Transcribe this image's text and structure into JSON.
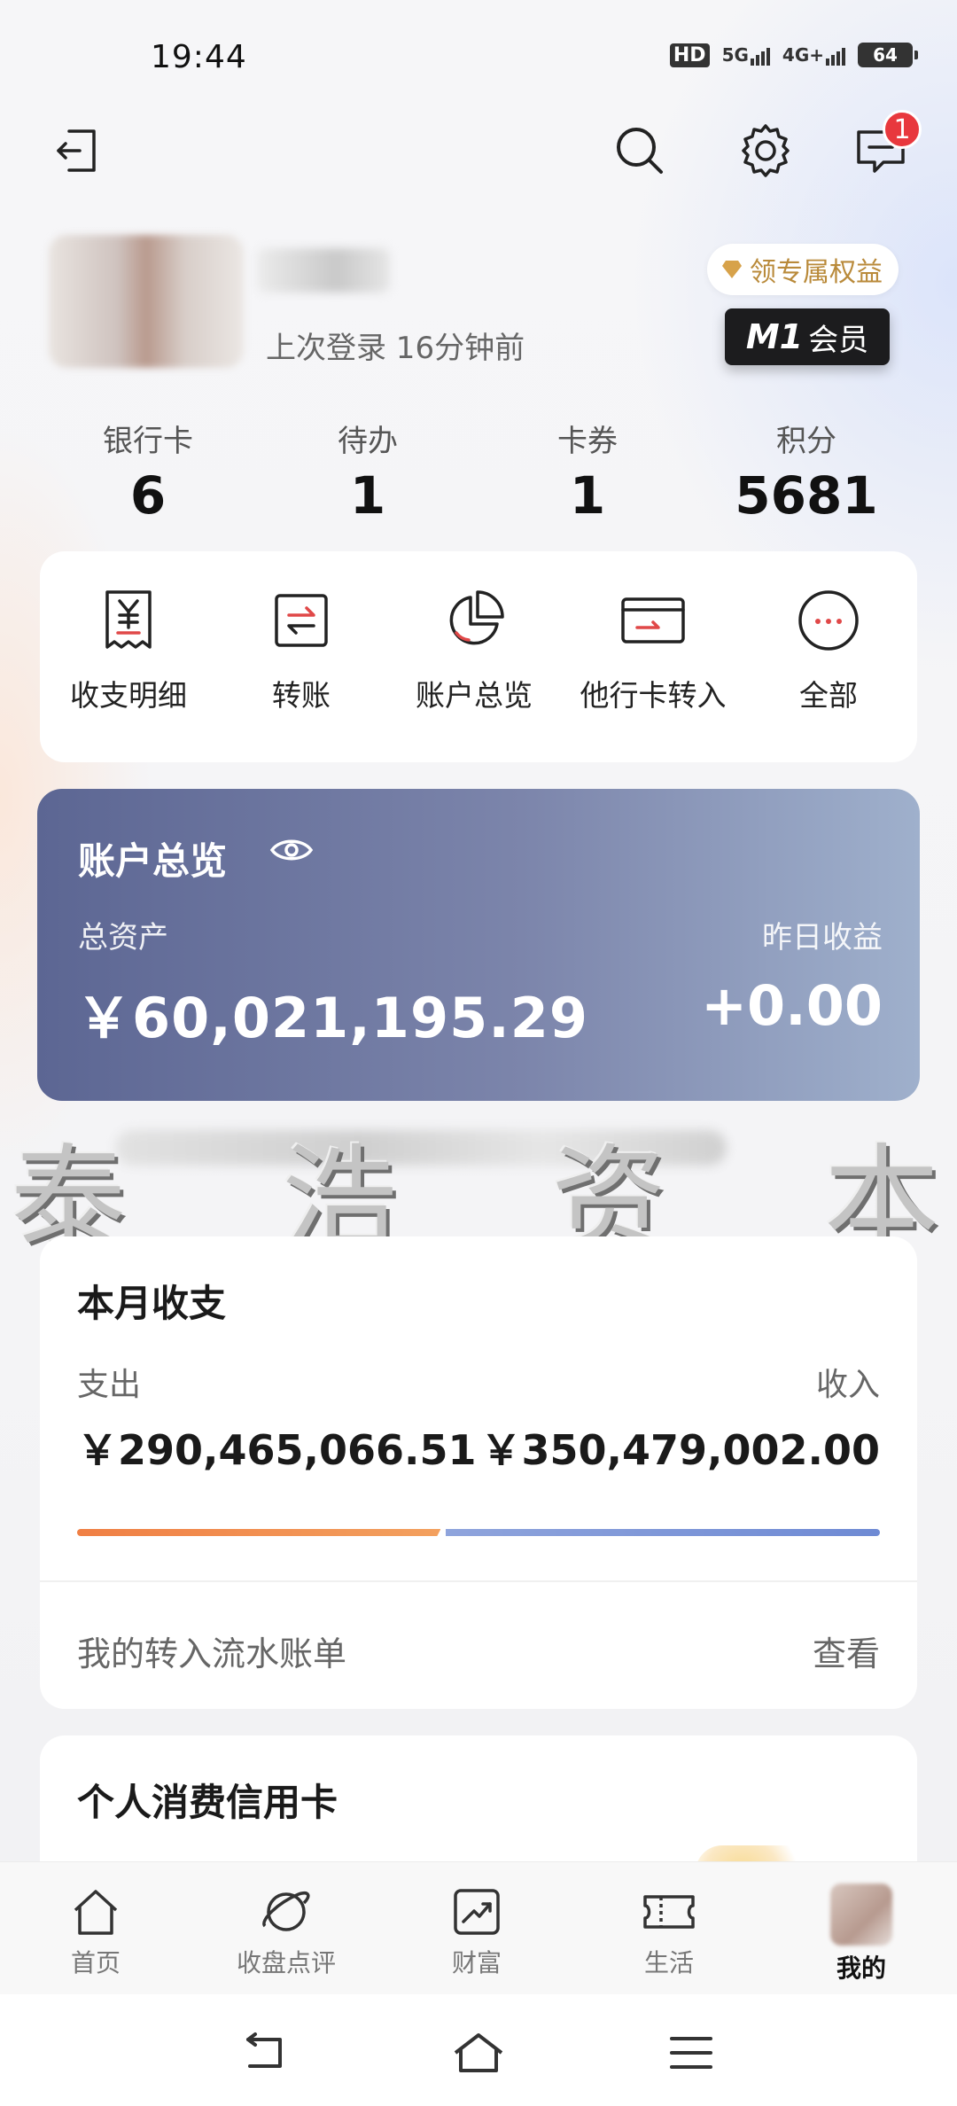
{
  "status_bar": {
    "time": "19:44",
    "signal_hd": "HD",
    "net_1": "5G",
    "net_2": "4G+",
    "battery": "64"
  },
  "header": {
    "unread_count": "1"
  },
  "profile": {
    "last_login": "上次登录 16分钟前",
    "benefit_label": "领专属权益",
    "member_level": "M1",
    "member_label": "会员"
  },
  "stats": [
    {
      "label": "银行卡",
      "value": "6"
    },
    {
      "label": "待办",
      "value": "1"
    },
    {
      "label": "卡券",
      "value": "1"
    },
    {
      "label": "积分",
      "value": "5681"
    }
  ],
  "quick_actions": [
    {
      "label": "收支明细",
      "icon": "receipt-icon"
    },
    {
      "label": "转账",
      "icon": "transfer-icon"
    },
    {
      "label": "账户总览",
      "icon": "pie-chart-icon"
    },
    {
      "label": "他行卡转入",
      "icon": "card-in-icon"
    },
    {
      "label": "全部",
      "icon": "more-icon"
    }
  ],
  "overview": {
    "title": "账户总览",
    "total_label": "总资产",
    "total_value": "￥60,021,195.29",
    "yield_label": "昨日收益",
    "yield_value": "+0.00"
  },
  "watermark": [
    "泰",
    "浩",
    "资",
    "本"
  ],
  "monthly": {
    "title": "本月收支",
    "expense_label": "支出",
    "income_label": "收入",
    "expense_value": "￥290,465,066.51",
    "income_value": "￥350,479,002.00",
    "expense_share": 0.453,
    "link_text": "我的转入流水账单",
    "link_action": "查看"
  },
  "credit": {
    "title": "个人消费信用卡"
  },
  "tabs": [
    {
      "label": "首页",
      "icon": "home-icon"
    },
    {
      "label": "收盘点评",
      "icon": "planet-icon"
    },
    {
      "label": "财富",
      "icon": "wealth-chart-icon"
    },
    {
      "label": "生活",
      "icon": "ticket-icon"
    },
    {
      "label": "我的",
      "icon": "avatar"
    }
  ],
  "colors": {
    "overview_start": "#5c6693",
    "overview_end": "#9fb0cc",
    "expense": "#f07f44",
    "income": "#6e8ad4",
    "badge": "#e8383d",
    "benefit": "#b98a3a"
  }
}
